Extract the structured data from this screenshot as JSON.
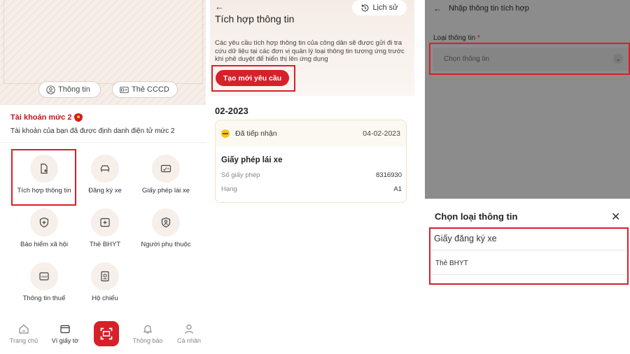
{
  "panel1": {
    "pills": {
      "info": "Thông tin",
      "cccd": "Thẻ CCCD"
    },
    "account_level": "Tài khoản mức 2",
    "account_desc": "Tài khoản của bạn đã được định danh điện tử mức 2",
    "grid": [
      {
        "label": "Tích hợp thông tin",
        "icon": "file-plus-icon"
      },
      {
        "label": "Đăng ký xe",
        "icon": "car-icon"
      },
      {
        "label": "Giấy phép lái xe",
        "icon": "license-card-icon"
      },
      {
        "label": "Bảo hiểm xã hội",
        "icon": "shield-plus-icon"
      },
      {
        "label": "Thẻ BHYT",
        "icon": "health-card-icon"
      },
      {
        "label": "Người phụ thuộc",
        "icon": "person-badge-icon"
      },
      {
        "label": "Thông tin thuế",
        "icon": "vnd-tax-icon"
      },
      {
        "label": "Hộ chiếu",
        "icon": "passport-icon"
      }
    ],
    "nav": [
      {
        "label": "Trang chủ",
        "icon": "home-icon"
      },
      {
        "label": "Ví giấy tờ",
        "icon": "wallet-icon"
      },
      {
        "label": "Thông báo",
        "icon": "bell-icon"
      },
      {
        "label": "Cá nhân",
        "icon": "person-icon"
      }
    ],
    "accent": "#d6202a"
  },
  "panel2": {
    "history_label": "Lịch sử",
    "title": "Tích hợp thông tin",
    "description": "Các yêu cầu tích hợp thông tin của công dân sẽ được gửi đi tra cứu dữ liệu tại các đơn vị quản lý loại thông tin tương ứng trước khi phê duyệt để hiển thị lên ứng dụng",
    "create_label": "Tạo mới yêu cầu",
    "month": "02-2023",
    "record": {
      "status": "Đã tiếp nhận",
      "date": "04-02-2023",
      "name": "Giấy phép lái xe",
      "rows": [
        {
          "label": "Số giấy phép",
          "value": "8316930"
        },
        {
          "label": "Hạng",
          "value": "A1"
        }
      ]
    }
  },
  "panel3": {
    "header_title": "Nhập thông tin tích hợp",
    "field_label": "Loại thông tin",
    "required_mark": "*",
    "select_placeholder": "Chọn thông tin",
    "sheet_title": "Chọn loại thông tin",
    "options": [
      "Giấy đăng ký xe",
      "Thẻ BHYT"
    ]
  }
}
